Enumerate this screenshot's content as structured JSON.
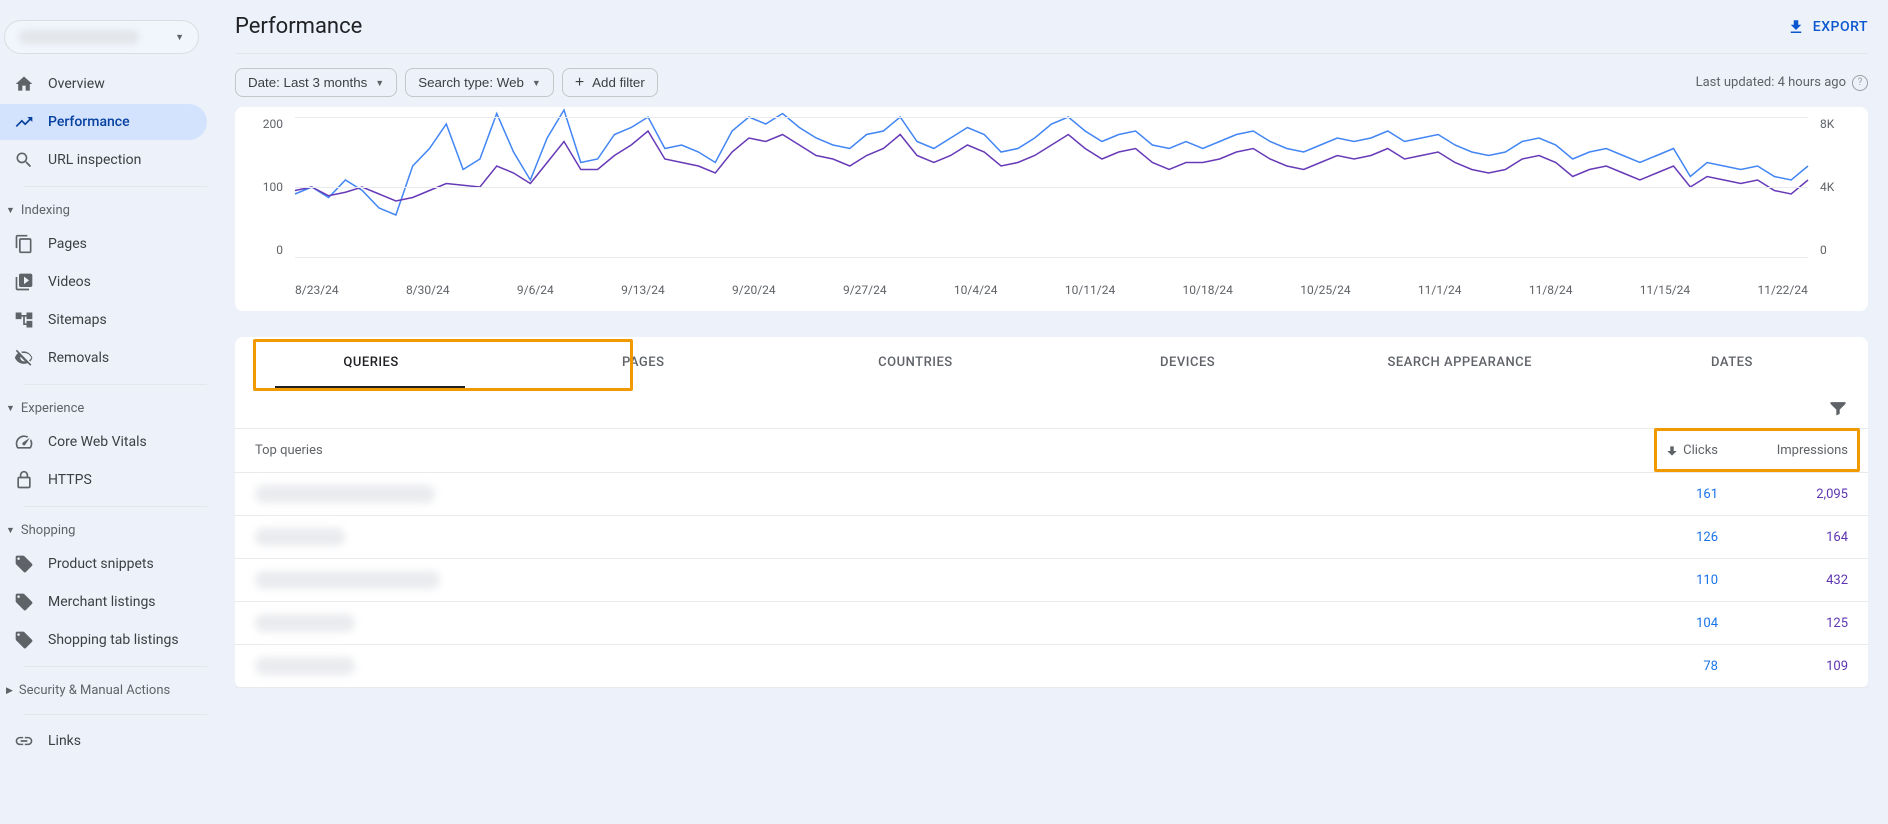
{
  "header": {
    "title": "Performance",
    "export_label": "EXPORT"
  },
  "filters": {
    "date_label": "Date: Last 3 months",
    "search_type_label": "Search type: Web",
    "add_filter_label": "Add filter",
    "last_updated": "Last updated: 4 hours ago"
  },
  "sidebar": {
    "items_main": [
      {
        "label": "Overview",
        "id": "overview"
      },
      {
        "label": "Performance",
        "id": "performance"
      },
      {
        "label": "URL inspection",
        "id": "url-inspection"
      }
    ],
    "section_indexing": "Indexing",
    "items_indexing": [
      {
        "label": "Pages"
      },
      {
        "label": "Videos"
      },
      {
        "label": "Sitemaps"
      },
      {
        "label": "Removals"
      }
    ],
    "section_experience": "Experience",
    "items_experience": [
      {
        "label": "Core Web Vitals"
      },
      {
        "label": "HTTPS"
      }
    ],
    "section_shopping": "Shopping",
    "items_shopping": [
      {
        "label": "Product snippets"
      },
      {
        "label": "Merchant listings"
      },
      {
        "label": "Shopping tab listings"
      }
    ],
    "section_security": "Security & Manual Actions",
    "section_links": "Links"
  },
  "tabs": {
    "items": [
      {
        "label": "QUERIES"
      },
      {
        "label": "PAGES"
      },
      {
        "label": "COUNTRIES"
      },
      {
        "label": "DEVICES"
      },
      {
        "label": "SEARCH APPEARANCE"
      },
      {
        "label": "DATES"
      }
    ]
  },
  "table": {
    "head_query": "Top queries",
    "head_clicks": "Clicks",
    "head_impressions": "Impressions",
    "rows": [
      {
        "clicks": "161",
        "impressions": "2,095",
        "qw": 180
      },
      {
        "clicks": "126",
        "impressions": "164",
        "qw": 90
      },
      {
        "clicks": "110",
        "impressions": "432",
        "qw": 185
      },
      {
        "clicks": "104",
        "impressions": "125",
        "qw": 100
      },
      {
        "clicks": "78",
        "impressions": "109",
        "qw": 100
      }
    ]
  },
  "chart_data": {
    "type": "line",
    "x_labels": [
      "8/23/24",
      "8/30/24",
      "9/6/24",
      "9/13/24",
      "9/20/24",
      "9/27/24",
      "10/4/24",
      "10/11/24",
      "10/18/24",
      "10/25/24",
      "11/1/24",
      "11/8/24",
      "11/15/24",
      "11/22/24"
    ],
    "y_left": {
      "ticks": [
        "200",
        "100",
        "0"
      ],
      "range": [
        0,
        200
      ]
    },
    "y_right": {
      "ticks": [
        "8K",
        "4K",
        "0"
      ],
      "range": [
        0,
        8000
      ]
    },
    "series": [
      {
        "name": "Clicks",
        "color": "#4285f4",
        "axis": "left",
        "values": [
          90,
          100,
          85,
          110,
          95,
          70,
          60,
          130,
          155,
          190,
          125,
          140,
          205,
          150,
          110,
          170,
          210,
          135,
          140,
          175,
          185,
          200,
          155,
          160,
          150,
          135,
          180,
          200,
          190,
          205,
          185,
          170,
          160,
          155,
          175,
          180,
          200,
          165,
          155,
          170,
          185,
          175,
          150,
          155,
          170,
          190,
          200,
          180,
          165,
          175,
          180,
          160,
          155,
          165,
          155,
          165,
          175,
          180,
          165,
          155,
          150,
          160,
          170,
          165,
          170,
          180,
          165,
          170,
          175,
          160,
          150,
          145,
          150,
          165,
          170,
          160,
          140,
          150,
          155,
          145,
          135,
          145,
          155,
          115,
          135,
          130,
          125,
          130,
          115,
          110,
          130
        ]
      },
      {
        "name": "Impressions",
        "color": "#673ab7",
        "axis": "right",
        "values": [
          3800,
          4000,
          3500,
          3700,
          4000,
          3600,
          3200,
          3400,
          3800,
          4200,
          4100,
          4000,
          5200,
          4800,
          4200,
          5400,
          6600,
          5000,
          5000,
          5800,
          6400,
          7200,
          5600,
          5400,
          5200,
          4800,
          6000,
          6800,
          6600,
          7000,
          6400,
          5800,
          5600,
          5200,
          5800,
          6200,
          7000,
          5800,
          5400,
          5800,
          6400,
          6000,
          5200,
          5400,
          5800,
          6400,
          7000,
          6200,
          5600,
          6000,
          6200,
          5400,
          5000,
          5400,
          5400,
          5600,
          6000,
          6200,
          5600,
          5200,
          5000,
          5400,
          5800,
          5600,
          5800,
          6200,
          5600,
          5800,
          6000,
          5400,
          5000,
          4800,
          5000,
          5600,
          5800,
          5400,
          4600,
          5000,
          5200,
          4800,
          4400,
          4800,
          5200,
          4000,
          4600,
          4400,
          4200,
          4400,
          3800,
          3600,
          4400
        ]
      }
    ]
  }
}
